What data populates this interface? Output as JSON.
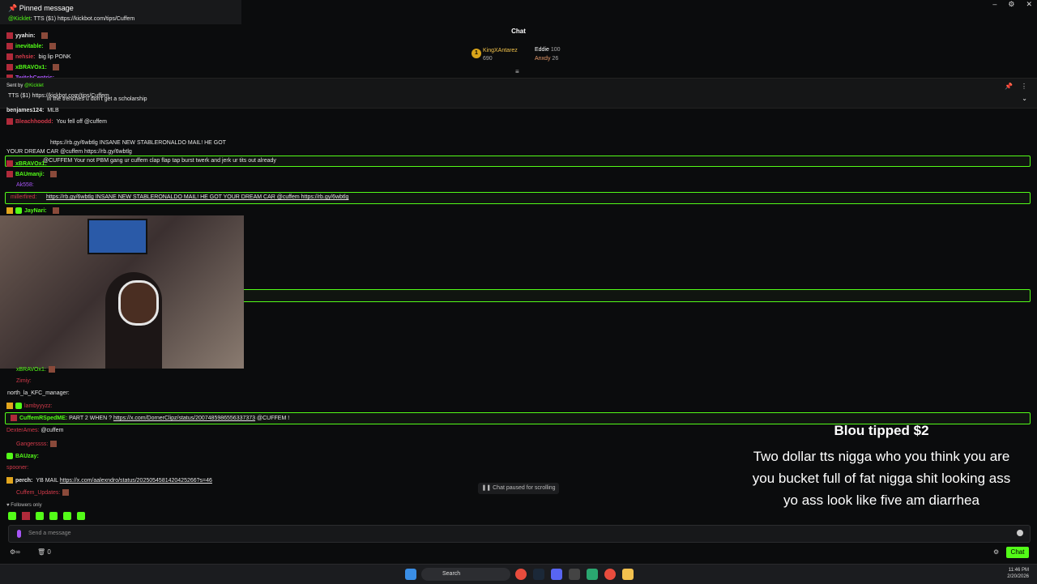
{
  "pinned": {
    "header": "Pinned message",
    "user": "@Kicklet",
    "text": ": TTS ($1) https://kickbot.com/tips/Cuffem"
  },
  "chat_title": "Chat",
  "leaderboard": {
    "first": {
      "rank": "1",
      "name": "KingXAntarez",
      "value": "690"
    },
    "second": {
      "name": "Eddie",
      "value": "100"
    },
    "third": {
      "name": "Anxdy",
      "value": "26"
    }
  },
  "pinbar": {
    "sent_by": "Sent by",
    "user": "@Kicklet",
    "text": "TTS ($1) https://kickbot.com/tips/Cuffem"
  },
  "messages": [
    {
      "user": "yyahin:",
      "text": "",
      "color": "#e8e8e8"
    },
    {
      "user": "inevitable:",
      "text": "",
      "color": "#53fc18"
    },
    {
      "user": "nehsie:",
      "text": "big lip PONK",
      "color": "#d33a4a"
    },
    {
      "user": "xBRAVOx1:",
      "text": "",
      "color": "#53fc18"
    },
    {
      "user": "TwitchCentric:",
      "text": "",
      "color": "#a855f7"
    },
    {
      "user": "",
      "text": "in the trenches u don't get a scholarship",
      "color": "#e8e8e8"
    },
    {
      "user": "benjames124:",
      "text": "MLB",
      "color": "#e8e8e8"
    },
    {
      "user": "Bleachhoodd:",
      "text": "You fell off @cuffem",
      "color": "#d33a4a"
    },
    {
      "user": "",
      "text": "https://rb.gy/6wbtlg INSANE NEW STABLERONALDO MAIL! HE GOT",
      "color": "#e8e8e8"
    },
    {
      "user": "",
      "text": "YOUR DREAM CAR @cuffem https://rb.gy/6wbtlg",
      "color": "#e8e8e8"
    },
    {
      "user": "xBRAVOx1:",
      "text": "",
      "color": "#53fc18"
    },
    {
      "user": "BAUmanji:",
      "text": "",
      "color": "#53fc18"
    }
  ],
  "highlight1": "@CUFFEM Your not PBM gang ur cuffem clap flap tap burst twerk and jerk ur tits out already",
  "aks_user": "Ak558:",
  "highlight2": {
    "user": "millerfired:",
    "text": "https://rb.gy/6wbtlg INSANE NEW STABLERONALDO MAIL! HE GOT YOUR DREAM CAR @cuffem https://rb.gy/6wbtlg"
  },
  "jay_user": "JayNari:",
  "lower_messages": {
    "bravo": "xBRAVOx1:",
    "zimy": "Zimiy:",
    "north": "north_la_KFC_manager:",
    "lamb": "lambyyyzz:",
    "hl_user": "CuffemRSpedME:",
    "hl_text": "PART 2 WHEN ?",
    "hl_link": "https://x.com/DornerClipz/status/2007485986556337373",
    "hl_tail": "@CUFFEM !",
    "dexter": "DexterAmes:",
    "dexter_text": "@cuffem",
    "gangers": "Gangerssss:",
    "bauzay": "BAUzay:",
    "spooner": "spooner:",
    "perch": "perch:",
    "perch_text": "YB MAIL",
    "perch_link": "https://x.com/aalexndro/status/2025054581420425266?s=46",
    "cuffem_upd": "Cuffem_Updates:"
  },
  "followers_only": "Followers only",
  "tts": {
    "title": "Blou tipped $2",
    "line1": "Two dollar tts nigga who you think you are",
    "line2": "you bucket full of fat nigga shit looking ass",
    "line3": "yo ass look like five am diarrhea"
  },
  "paused": "Chat paused for scrolling",
  "input_placeholder": "Send a message",
  "footer_count": "0",
  "chat_button": "Chat",
  "search_label": "Search",
  "clock_time": "11:46 PM",
  "clock_date": "2/20/2026",
  "colors": {
    "accent": "#53fc18",
    "background": "#0b0c0d"
  }
}
